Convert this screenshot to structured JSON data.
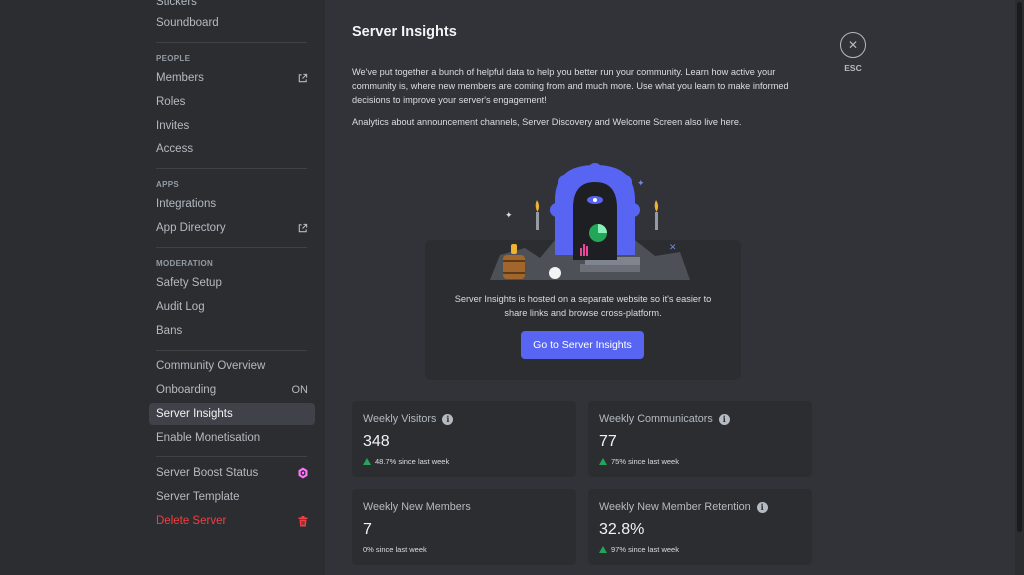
{
  "sidebar": {
    "top_items": [
      {
        "label": "Stickers"
      },
      {
        "label": "Soundboard"
      }
    ],
    "people": {
      "heading": "PEOPLE",
      "members": "Members",
      "roles": "Roles",
      "invites": "Invites",
      "access": "Access"
    },
    "apps": {
      "heading": "APPS",
      "integrations": "Integrations",
      "app_directory": "App Directory"
    },
    "moderation": {
      "heading": "MODERATION",
      "safety_setup": "Safety Setup",
      "audit_log": "Audit Log",
      "bans": "Bans"
    },
    "community": {
      "overview": "Community Overview",
      "onboarding": "Onboarding",
      "onboarding_status": "ON",
      "server_insights": "Server Insights",
      "monetisation": "Enable Monetisation"
    },
    "server": {
      "boost_status": "Server Boost Status",
      "template": "Server Template",
      "delete": "Delete Server"
    }
  },
  "main": {
    "title": "Server Insights",
    "intro": "We've put together a bunch of helpful data to help you better run your community. Learn how active your community is, where new members are coming from and much more. Use what you learn to make informed decisions to improve your server's engagement!",
    "analytics_note": "Analytics about announcement channels, Server Discovery and Welcome Screen also live here.",
    "esc_label": "ESC",
    "promo_text": "Server Insights is hosted on a separate website so it's easier to share links and browse cross-platform.",
    "promo_button": "Go to Server Insights",
    "stats": {
      "weekly_visitors": {
        "title": "Weekly Visitors",
        "value": "348",
        "delta": "48.7% since last week"
      },
      "weekly_communicators": {
        "title": "Weekly Communicators",
        "value": "77",
        "delta": "75% since last week"
      },
      "weekly_new_members": {
        "title": "Weekly New Members",
        "value": "7",
        "delta": "0% since last week"
      },
      "new_member_retention": {
        "title": "Weekly New Member Retention",
        "value": "32.8%",
        "delta": "97% since last week"
      }
    }
  },
  "colors": {
    "accent": "#5865f2",
    "danger": "#f23f43",
    "positive": "#23a55a",
    "boost": "#ff73fa"
  }
}
